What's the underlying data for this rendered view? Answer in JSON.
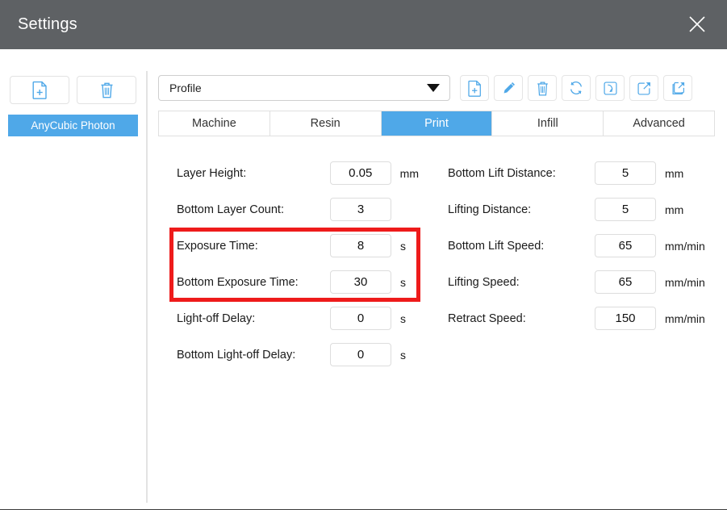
{
  "window": {
    "title": "Settings",
    "close_icon": "close-icon"
  },
  "theme": {
    "titlebar_bg": "#5e6164",
    "accent_blue": "#4fa8e8",
    "highlight_red": "#ee1b1b",
    "icon_blue": "#4fa8e8",
    "text": "#1a1a1a"
  },
  "sidebar": {
    "toolbar": [
      {
        "name": "new-profile-button",
        "icon": "new-file-icon"
      },
      {
        "name": "delete-profile-button",
        "icon": "trash-icon"
      }
    ],
    "profiles": [
      {
        "label": "AnyCubic Photon",
        "selected": true
      }
    ]
  },
  "profile_bar": {
    "select_value": "Profile",
    "chevron_icon": "chevron-down-icon",
    "actions": [
      {
        "name": "new-button",
        "icon": "new-file-icon"
      },
      {
        "name": "edit-button",
        "icon": "pencil-icon"
      },
      {
        "name": "delete-button",
        "icon": "trash-icon"
      },
      {
        "name": "reset-button",
        "icon": "refresh-icon"
      },
      {
        "name": "import-button",
        "icon": "import-icon"
      },
      {
        "name": "export-button",
        "icon": "export-icon"
      },
      {
        "name": "export-all-button",
        "icon": "export-all-icon"
      }
    ]
  },
  "tabs": [
    {
      "label": "Machine",
      "active": false
    },
    {
      "label": "Resin",
      "active": false
    },
    {
      "label": "Print",
      "active": true
    },
    {
      "label": "Infill",
      "active": false
    },
    {
      "label": "Advanced",
      "active": false
    }
  ],
  "settings": {
    "left_column": [
      {
        "label": "Layer Height:",
        "value": "0.05",
        "unit": "mm",
        "highlighted": false
      },
      {
        "label": "Bottom Layer Count:",
        "value": "3",
        "unit": "",
        "highlighted": false
      },
      {
        "label": "Exposure Time:",
        "value": "8",
        "unit": "s",
        "highlighted": true
      },
      {
        "label": "Bottom Exposure Time:",
        "value": "30",
        "unit": "s",
        "highlighted": true
      },
      {
        "label": "Light-off Delay:",
        "value": "0",
        "unit": "s",
        "highlighted": false
      },
      {
        "label": "Bottom Light-off Delay:",
        "value": "0",
        "unit": "s",
        "highlighted": false
      }
    ],
    "right_column": [
      {
        "label": "Bottom Lift Distance:",
        "value": "5",
        "unit": "mm"
      },
      {
        "label": "Lifting Distance:",
        "value": "5",
        "unit": "mm"
      },
      {
        "label": "Bottom Lift Speed:",
        "value": "65",
        "unit": "mm/min"
      },
      {
        "label": "Lifting Speed:",
        "value": "65",
        "unit": "mm/min"
      },
      {
        "label": "Retract Speed:",
        "value": "150",
        "unit": "mm/min"
      }
    ]
  }
}
